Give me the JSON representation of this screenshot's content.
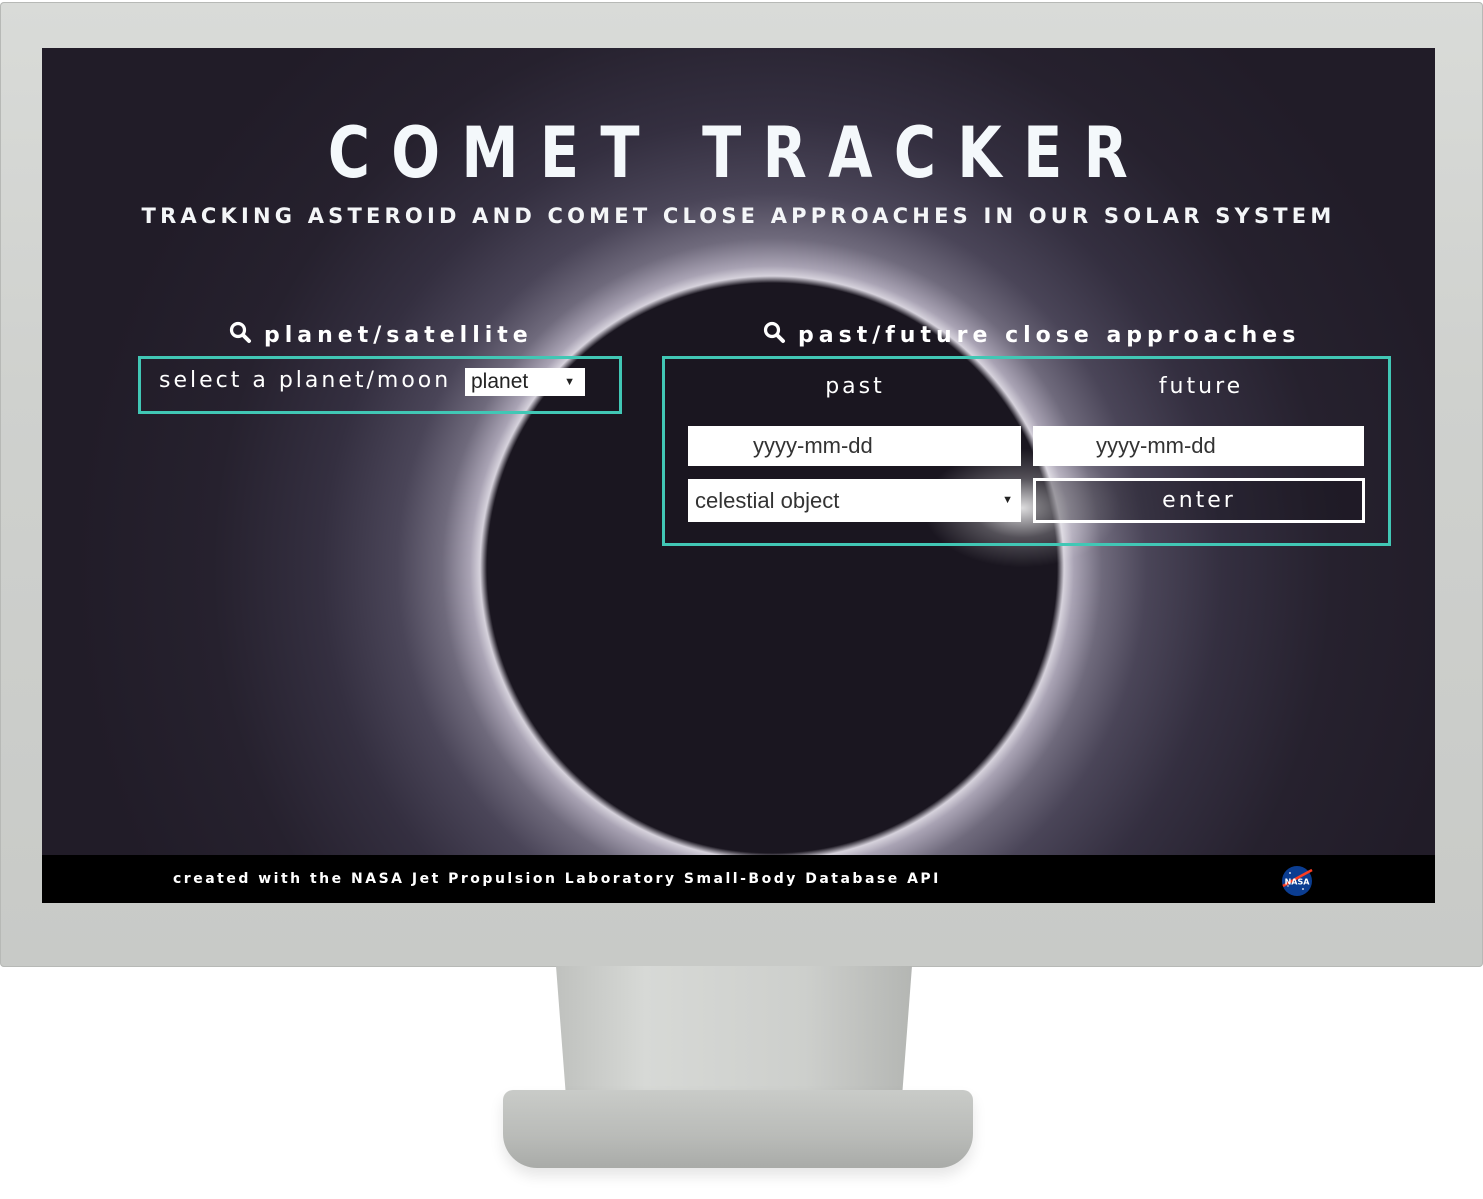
{
  "header": {
    "title": "COMET TRACKER",
    "subtitle": "TRACKING ASTEROID AND COMET CLOSE APPROACHES IN OUR SOLAR SYSTEM"
  },
  "planet_section": {
    "heading": "planet/satellite",
    "icon": "search-icon",
    "row_label": "select a planet/moon",
    "select_value": "planet"
  },
  "approach_section": {
    "heading": "past/future close approaches",
    "icon": "search-icon",
    "past_label": "past",
    "future_label": "future",
    "past_date_placeholder": "yyyy-mm-dd",
    "future_date_placeholder": "yyyy-mm-dd",
    "object_select_value": "celestial object",
    "enter_label": "enter"
  },
  "footer": {
    "credit": "created with the NASA Jet Propulsion Laboratory Small-Body Database API",
    "logo_text": "NASA"
  },
  "colors": {
    "accent": "#41c7b5",
    "background": "#221d2a",
    "footer": "#000000"
  }
}
